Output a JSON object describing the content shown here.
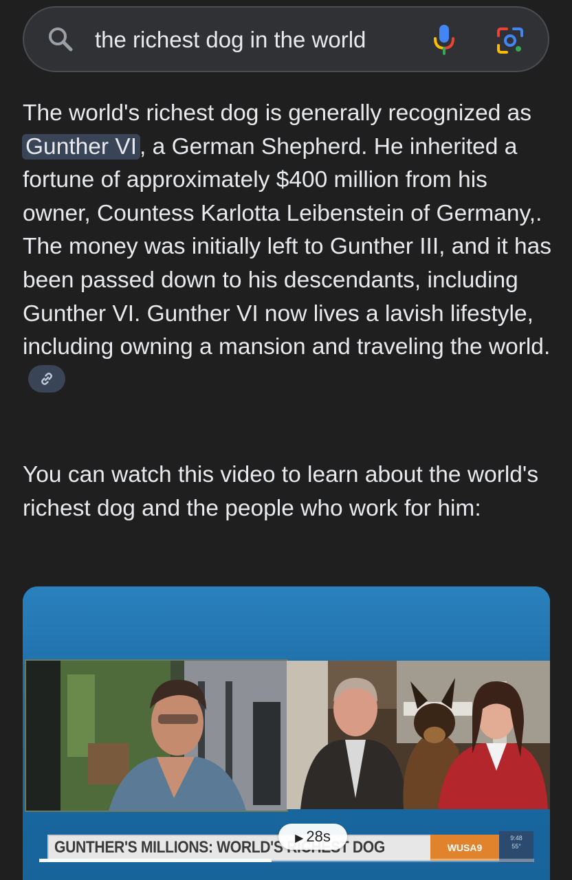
{
  "search": {
    "query": "the richest dog in the world"
  },
  "answer": {
    "before": "The world's richest dog is generally recognized as ",
    "highlight": "Gunther VI",
    "after": ", a German Shepherd. He inherited a fortune of approximately $400 million from his owner, Countess Karlotta Leibenstein of Germany,. The money was initially left to Gunther III, and it has been passed down to his descendants, including Gunther VI. Gunther VI now lives a lavish lifestyle, including owning a mansion and traveling the world."
  },
  "intro": "You can watch this video to learn about the world's richest dog and the people who work for him:",
  "video": {
    "lower_third": "GUNTHER'S MILLIONS: WORLD'S RICHEST DOG",
    "channel": "WUSA9",
    "duration": "28s",
    "weather": [
      "9:48",
      "55°"
    ],
    "progress": 0.47
  },
  "colors": {
    "background": "#1f1f1f",
    "search_bg": "#303134",
    "highlight": "#394457",
    "video_frame": "#1d6fa6"
  },
  "icons": [
    "search-icon",
    "mic-icon",
    "lens-icon",
    "link-icon",
    "play-icon"
  ]
}
